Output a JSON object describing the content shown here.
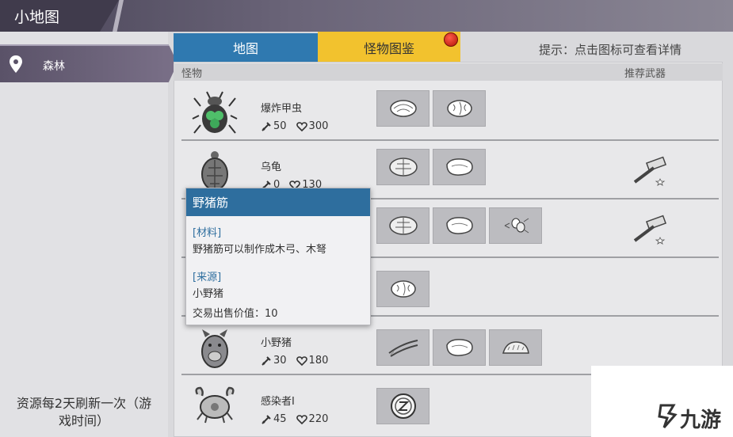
{
  "topbar": {
    "title": "小地图"
  },
  "left": {
    "location": "森林",
    "refresh_note_line1": "资源每2天刷新一次（游",
    "refresh_note_line2": "戏时间）"
  },
  "tabs": {
    "map": "地图",
    "monster": "怪物图鉴"
  },
  "hint": "提示：点击图标可查看详情",
  "headers": {
    "monster": "怪物",
    "weapon": "推荐武器"
  },
  "monsters": [
    {
      "name": "爆炸甲虫",
      "attack": "50",
      "hp": "300"
    },
    {
      "name": "乌龟",
      "attack": "0",
      "hp": "130"
    },
    {
      "name": "",
      "attack": "",
      "hp": ""
    },
    {
      "name": "",
      "attack": "",
      "hp": ""
    },
    {
      "name": "小野猪",
      "attack": "30",
      "hp": "180"
    },
    {
      "name": "感染者I",
      "attack": "45",
      "hp": "220"
    }
  ],
  "tooltip": {
    "title": "野猪筋",
    "material_tag": "[材料]",
    "material_text": "野猪筋可以制作成木弓、木弩",
    "source_tag": "[来源]",
    "source_text": "小野猪",
    "price": "交易出售价值：10"
  },
  "watermark": "九游",
  "colors": {
    "tab_map": "#2f79b0",
    "tab_monster": "#f2c22e",
    "tooltip_header": "#2e6e9e",
    "alert_dot": "#d42a18"
  }
}
